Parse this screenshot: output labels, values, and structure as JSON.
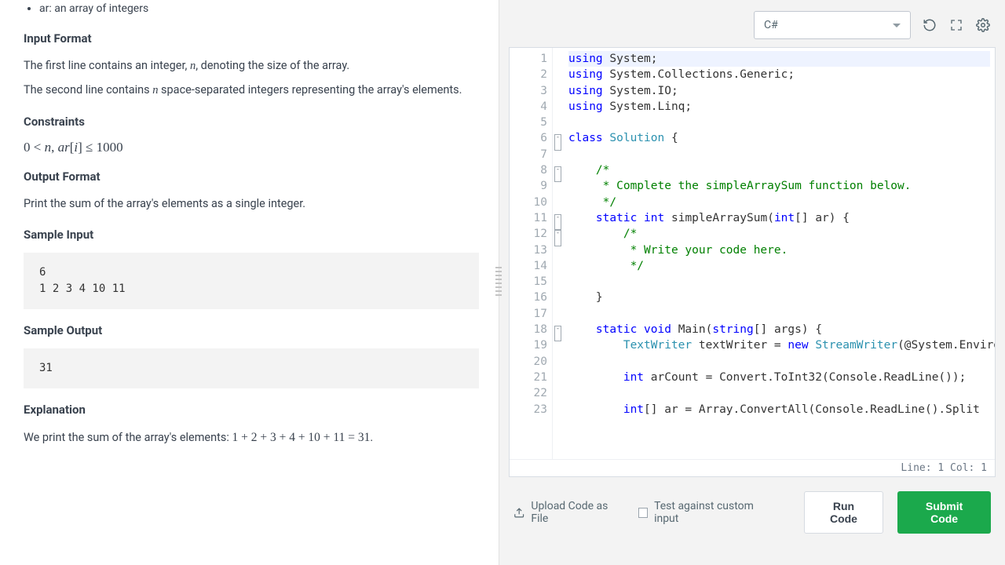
{
  "problem": {
    "param_desc": "ar: an array of integers",
    "h_input_format": "Input Format",
    "input_line1_a": "The first line contains an integer, ",
    "input_line1_var": "n",
    "input_line1_b": ", denoting the size of the array.",
    "input_line2_a": "The second line contains ",
    "input_line2_var": "n",
    "input_line2_b": " space-separated integers representing the array's elements.",
    "h_constraints": "Constraints",
    "constraints_math": "0 < n, ar[i] ≤ 1000",
    "h_output_format": "Output Format",
    "output_desc": "Print the sum of the array's elements as a single integer.",
    "h_sample_input": "Sample Input",
    "sample_input": "6\n1 2 3 4 10 11",
    "h_sample_output": "Sample Output",
    "sample_output": "31",
    "h_explanation": "Explanation",
    "explanation_a": "We print the sum of the array's elements: ",
    "explanation_math": "1 + 2 + 3 + 4 + 10 + 11 = 31",
    "explanation_b": "."
  },
  "editor": {
    "language": "C#",
    "status": "Line: 1 Col: 1",
    "lines": [
      {
        "n": 1,
        "fold": "",
        "html": "<span class='kw'>using</span> System;"
      },
      {
        "n": 2,
        "fold": "",
        "html": "<span class='kw'>using</span> System.Collections.Generic;"
      },
      {
        "n": 3,
        "fold": "",
        "html": "<span class='kw'>using</span> System.IO;"
      },
      {
        "n": 4,
        "fold": "",
        "html": "<span class='kw'>using</span> System.Linq;"
      },
      {
        "n": 5,
        "fold": "",
        "html": ""
      },
      {
        "n": 6,
        "fold": "-",
        "html": "<span class='kw'>class</span> <span class='cls'>Solution</span> {"
      },
      {
        "n": 7,
        "fold": "",
        "html": ""
      },
      {
        "n": 8,
        "fold": "-",
        "html": "    <span class='cmt'>/*</span>"
      },
      {
        "n": 9,
        "fold": "",
        "html": "<span class='cmt'>     * Complete the simpleArraySum function below.</span>"
      },
      {
        "n": 10,
        "fold": "",
        "html": "<span class='cmt'>     */</span>"
      },
      {
        "n": 11,
        "fold": "-",
        "html": "    <span class='kw'>static</span> <span class='kw'>int</span> simpleArraySum(<span class='kw'>int</span>[] ar) {"
      },
      {
        "n": 12,
        "fold": "-",
        "html": "        <span class='cmt'>/*</span>"
      },
      {
        "n": 13,
        "fold": "",
        "html": "<span class='cmt'>         * Write your code here.</span>"
      },
      {
        "n": 14,
        "fold": "",
        "html": "<span class='cmt'>         */</span>"
      },
      {
        "n": 15,
        "fold": "",
        "html": ""
      },
      {
        "n": 16,
        "fold": "",
        "html": "    }"
      },
      {
        "n": 17,
        "fold": "",
        "html": ""
      },
      {
        "n": 18,
        "fold": "-",
        "html": "    <span class='kw'>static</span> <span class='kw'>void</span> Main(<span class='kw'>string</span>[] args) {"
      },
      {
        "n": 19,
        "fold": "",
        "html": "        <span class='cls'>TextWriter</span> textWriter = <span class='kw'>new</span> <span class='cls'>StreamWriter</span>(@System.Environment.GetEnvironmentVariable(<span class='str'>\"OUTPUT_PATH\"</span>), <span class='kw'>true</span>);"
      },
      {
        "n": 20,
        "fold": "",
        "html": ""
      },
      {
        "n": 21,
        "fold": "",
        "html": "        <span class='kw'>int</span> arCount = Convert.ToInt32(Console.ReadLine());"
      },
      {
        "n": 22,
        "fold": "",
        "html": ""
      },
      {
        "n": 23,
        "fold": "",
        "html": "        <span class='kw'>int</span>[] ar = Array.ConvertAll(Console.ReadLine().Split"
      }
    ]
  },
  "footer": {
    "upload": "Upload Code as File",
    "custom_input": "Test against custom input",
    "run": "Run Code",
    "submit": "Submit Code"
  }
}
